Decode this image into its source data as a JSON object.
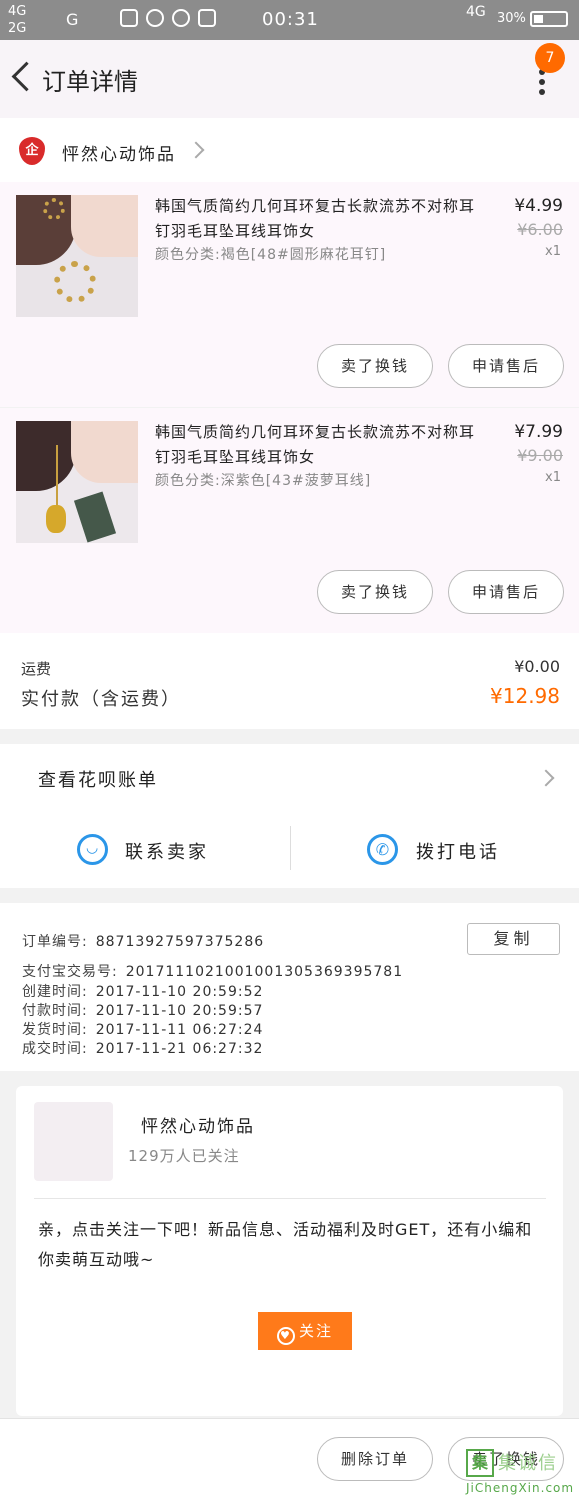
{
  "status_bar": {
    "network_left": "4G\n2G",
    "network_g": "G",
    "time": "00:31",
    "network_right": "4G",
    "battery": "30%"
  },
  "header": {
    "title": "订单详情",
    "badge_count": "7"
  },
  "shop": {
    "logo_text": "企",
    "name": "怦然心动饰品"
  },
  "items": [
    {
      "title": "韩国气质简约几何耳环复古长款流苏不对称耳钉羽毛耳坠耳线耳饰女",
      "spec": "颜色分类:褐色[48#圆形麻花耳钉]",
      "price": "¥4.99",
      "original_price": "¥6.00",
      "quantity": "x1",
      "return_label": "卖了换钱",
      "aftersale_label": "申请售后"
    },
    {
      "title": "韩国气质简约几何耳环复古长款流苏不对称耳钉羽毛耳坠耳线耳饰女",
      "spec": "颜色分类:深紫色[43#菠萝耳线]",
      "price": "¥7.99",
      "original_price": "¥9.00",
      "quantity": "x1",
      "return_label": "卖了换钱",
      "aftersale_label": "申请售后"
    }
  ],
  "fees": {
    "shipping_label": "运费",
    "shipping_value": "¥0.00",
    "paid_label": "实付款（含运费）",
    "paid_value": "¥12.98"
  },
  "bill": {
    "label": "查看花呗账单",
    "contact_label": "联系卖家",
    "call_label": "拨打电话"
  },
  "order_info": {
    "order_no_label": "订单编号:",
    "order_no": "887139275973752​86",
    "alipay_label": "支付宝交易号:",
    "alipay_no": "2017111021001001305369395781",
    "created_label": "创建时间:",
    "created": "2017-11-10 20:59:52",
    "paid_label": "付款时间:",
    "paid": "2017-11-10 20:59:57",
    "shipped_label": "发货时间:",
    "shipped": "2017-11-11 06:27:24",
    "completed_label": "成交时间:",
    "completed": "2017-11-21 06:27:32",
    "copy_label": "复制"
  },
  "shop_card": {
    "name": "怦然心动饰品",
    "followers": "129万人已关注",
    "message": "亲，点击关注一下吧！新品信息、活动福利及时GET，还有小编和你卖萌互动哦~",
    "follow_label": "关注"
  },
  "bottom": {
    "delete_label": "删除订单",
    "return_label": "卖了换钱"
  },
  "watermark": {
    "text": "集诚信",
    "url": "JiChengXin.com"
  }
}
